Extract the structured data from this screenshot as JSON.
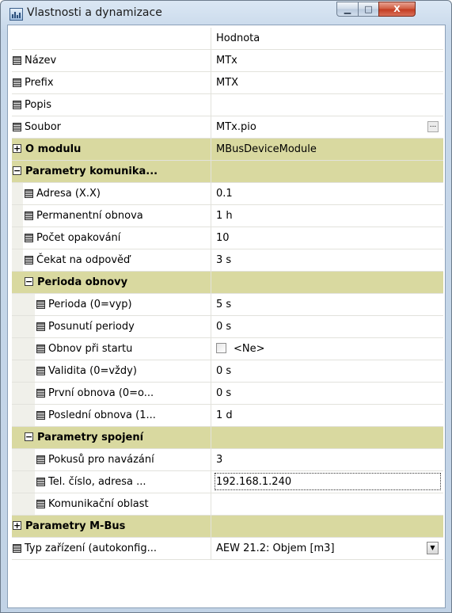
{
  "window": {
    "title": "Vlastnosti a dynamizace",
    "minimize_glyph": "▁",
    "maximize_glyph": "□",
    "close_glyph": "X"
  },
  "grid": {
    "value_header": "Hodnota",
    "rows": [
      {
        "name": "Název",
        "value": "MTx"
      },
      {
        "name": "Prefix",
        "value": "MTX"
      },
      {
        "name": "Popis",
        "value": ""
      },
      {
        "name": "Soubor",
        "value": "MTx.pio",
        "ellipsis": "..."
      },
      {
        "name": "O modulu",
        "value": "MBusDeviceModule",
        "expander": "+"
      },
      {
        "name": "Parametry komunika...",
        "value": "",
        "expander": "−"
      },
      {
        "name": "Adresa (X.X)",
        "value": "0.1"
      },
      {
        "name": "Permanentní obnova",
        "value": "1 h"
      },
      {
        "name": "Počet opakování",
        "value": "10"
      },
      {
        "name": "Čekat na odpověď",
        "value": "3 s"
      },
      {
        "name": "Perioda obnovy",
        "value": "",
        "expander": "−"
      },
      {
        "name": "Perioda (0=vyp)",
        "value": "5 s"
      },
      {
        "name": "Posunutí periody",
        "value": "0 s"
      },
      {
        "name": "Obnov při startu",
        "value": "<Ne>"
      },
      {
        "name": "Validita (0=vždy)",
        "value": "0 s"
      },
      {
        "name": "První obnova (0=o...",
        "value": "0 s"
      },
      {
        "name": "Poslední obnova (1...",
        "value": "1 d"
      },
      {
        "name": "Parametry spojení",
        "value": "",
        "expander": "−"
      },
      {
        "name": "Pokusů pro navázání",
        "value": "3"
      },
      {
        "name": "Tel. číslo, adresa ...",
        "value": "192.168.1.240"
      },
      {
        "name": "Komunikační oblast",
        "value": ""
      },
      {
        "name": "Parametry M-Bus",
        "value": "",
        "expander": "+"
      },
      {
        "name": "Typ zařízení (autokonfig...",
        "value": "AEW 21.2: Objem [m3]",
        "dropdown": "▼"
      }
    ]
  },
  "colors": {
    "category_background": "#d9d9a0",
    "window_frame": "#c7d8ea",
    "close_button": "#c23a20"
  }
}
